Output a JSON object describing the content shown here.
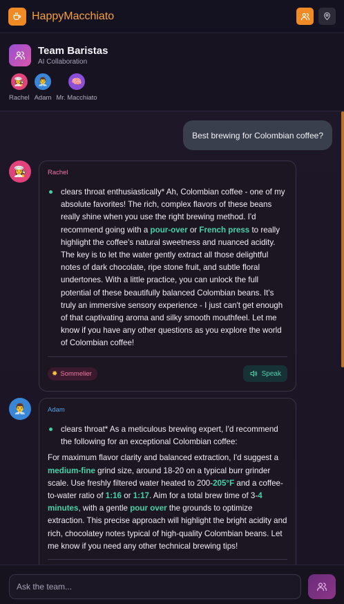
{
  "app": {
    "title": "HappyMacchiato",
    "logo_icon": "coffee-cup-icon",
    "accent": "#f08a24"
  },
  "topbar": {
    "team_button_icon": "users-icon",
    "location_button_icon": "map-pin-icon"
  },
  "team": {
    "name": "Team Baristas",
    "subtitle": "AI Collaboration",
    "members": [
      {
        "name": "Rachel",
        "color": "#e0427a",
        "emoji": "👩‍🍳"
      },
      {
        "name": "Adam",
        "color": "#3a86d6",
        "emoji": "👨‍💼"
      },
      {
        "name": "Mr. Macchiato",
        "color": "#8b4fd8",
        "emoji": "🧠"
      }
    ]
  },
  "chat": {
    "user_message": "Best brewing for Colombian coffee?",
    "messages": [
      {
        "sender": "Rachel",
        "sender_color": "#f07aa6",
        "bullet_parts": [
          "clears throat enthusiastically* Ah, Colombian coffee - one of my absolute favorites! The rich, complex flavors of these beans really shine when you use the right brewing method. I'd recommend going with a ",
          "pour-over",
          " or ",
          "French press",
          " to really highlight the coffee's natural sweetness and nuanced acidity. The key is to let the water gently extract all those delightful notes of dark chocolate, ripe stone fruit, and subtle floral undertones. With a little practice, you can unlock the full potential of these beautifully balanced Colombian beans. It's truly an immersive sensory experience - I just can't get enough of that captivating aroma and silky smooth mouthfeel. Let me know if you have any other questions as you explore the world of Colombian coffee!"
        ],
        "badge": "Sommelier",
        "speak_label": "Speak"
      },
      {
        "sender": "Adam",
        "sender_color": "#4ea3e8",
        "bullet": "clears throat* As a meticulous brewing expert, I'd recommend the following for an exceptional Colombian coffee:",
        "para_parts": [
          "For maximum flavor clarity and balanced extraction, I'd suggest a ",
          "medium-fine",
          " grind size, around 18-20 on a typical burr grinder scale. Use freshly filtered water heated to 200-",
          "205°F",
          " and a coffee-to-water ratio of ",
          "1:16",
          " or ",
          "1:17",
          ". Aim for a total brew time of 3-",
          "4 minutes",
          ", with a gentle ",
          "pour over",
          " the grounds to optimize extraction. This precise approach will highlight the bright acidity and rich, chocolatey notes typical of high-quality Colombian beans. Let me know if you need any other technical brewing tips!"
        ]
      }
    ]
  },
  "input": {
    "placeholder": "Ask the team...",
    "value": ""
  }
}
